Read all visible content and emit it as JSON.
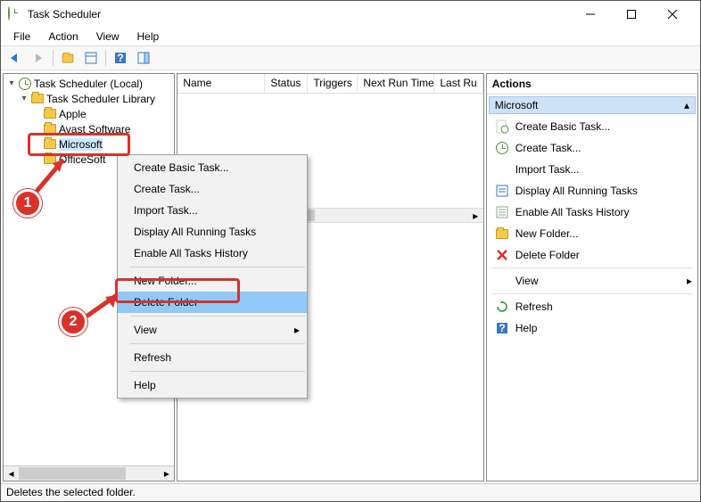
{
  "window": {
    "title": "Task Scheduler",
    "minimize_tip": "Minimize",
    "maximize_tip": "Maximize",
    "close_tip": "Close"
  },
  "menubar": {
    "items": [
      "File",
      "Action",
      "View",
      "Help"
    ]
  },
  "toolbar": {
    "back_icon": "back-arrow",
    "forward_icon": "forward-arrow",
    "up_icon": "folder-up",
    "props_icon": "properties",
    "help_icon": "help",
    "panes_icon": "show-hide-pane"
  },
  "tree": {
    "root": "Task Scheduler (Local)",
    "library": "Task Scheduler Library",
    "items": [
      "Apple",
      "Avast Software",
      "Microsoft",
      "OfficeSoft"
    ],
    "selected_index": 2
  },
  "list": {
    "columns": [
      "Name",
      "Status",
      "Triggers",
      "Next Run Time",
      "Last Ru"
    ]
  },
  "context_menu": {
    "items": [
      {
        "label": "Create Basic Task...",
        "type": "item"
      },
      {
        "label": "Create Task...",
        "type": "item"
      },
      {
        "label": "Import Task...",
        "type": "item"
      },
      {
        "label": "Display All Running Tasks",
        "type": "item"
      },
      {
        "label": "Enable All Tasks History",
        "type": "item"
      },
      {
        "type": "sep"
      },
      {
        "label": "New Folder...",
        "type": "item"
      },
      {
        "label": "Delete Folder",
        "type": "item",
        "selected": true
      },
      {
        "type": "sep"
      },
      {
        "label": "View",
        "type": "submenu"
      },
      {
        "type": "sep"
      },
      {
        "label": "Refresh",
        "type": "item"
      },
      {
        "type": "sep"
      },
      {
        "label": "Help",
        "type": "item"
      }
    ]
  },
  "actions": {
    "header": "Actions",
    "group_title": "Microsoft",
    "items": [
      {
        "icon": "clock-page",
        "label": "Create Basic Task..."
      },
      {
        "icon": "clock",
        "label": "Create Task..."
      },
      {
        "icon": "none",
        "label": "Import Task..."
      },
      {
        "icon": "list",
        "label": "Display All Running Tasks"
      },
      {
        "icon": "history",
        "label": "Enable All Tasks History"
      },
      {
        "icon": "folder",
        "label": "New Folder..."
      },
      {
        "icon": "delete",
        "label": "Delete Folder"
      },
      {
        "type": "sep"
      },
      {
        "icon": "none",
        "label": "View",
        "submenu": true
      },
      {
        "type": "sep"
      },
      {
        "icon": "refresh",
        "label": "Refresh"
      },
      {
        "icon": "help",
        "label": "Help"
      }
    ]
  },
  "statusbar": {
    "text": "Deletes the selected folder."
  },
  "annotations": {
    "badge1": "1",
    "badge2": "2"
  }
}
